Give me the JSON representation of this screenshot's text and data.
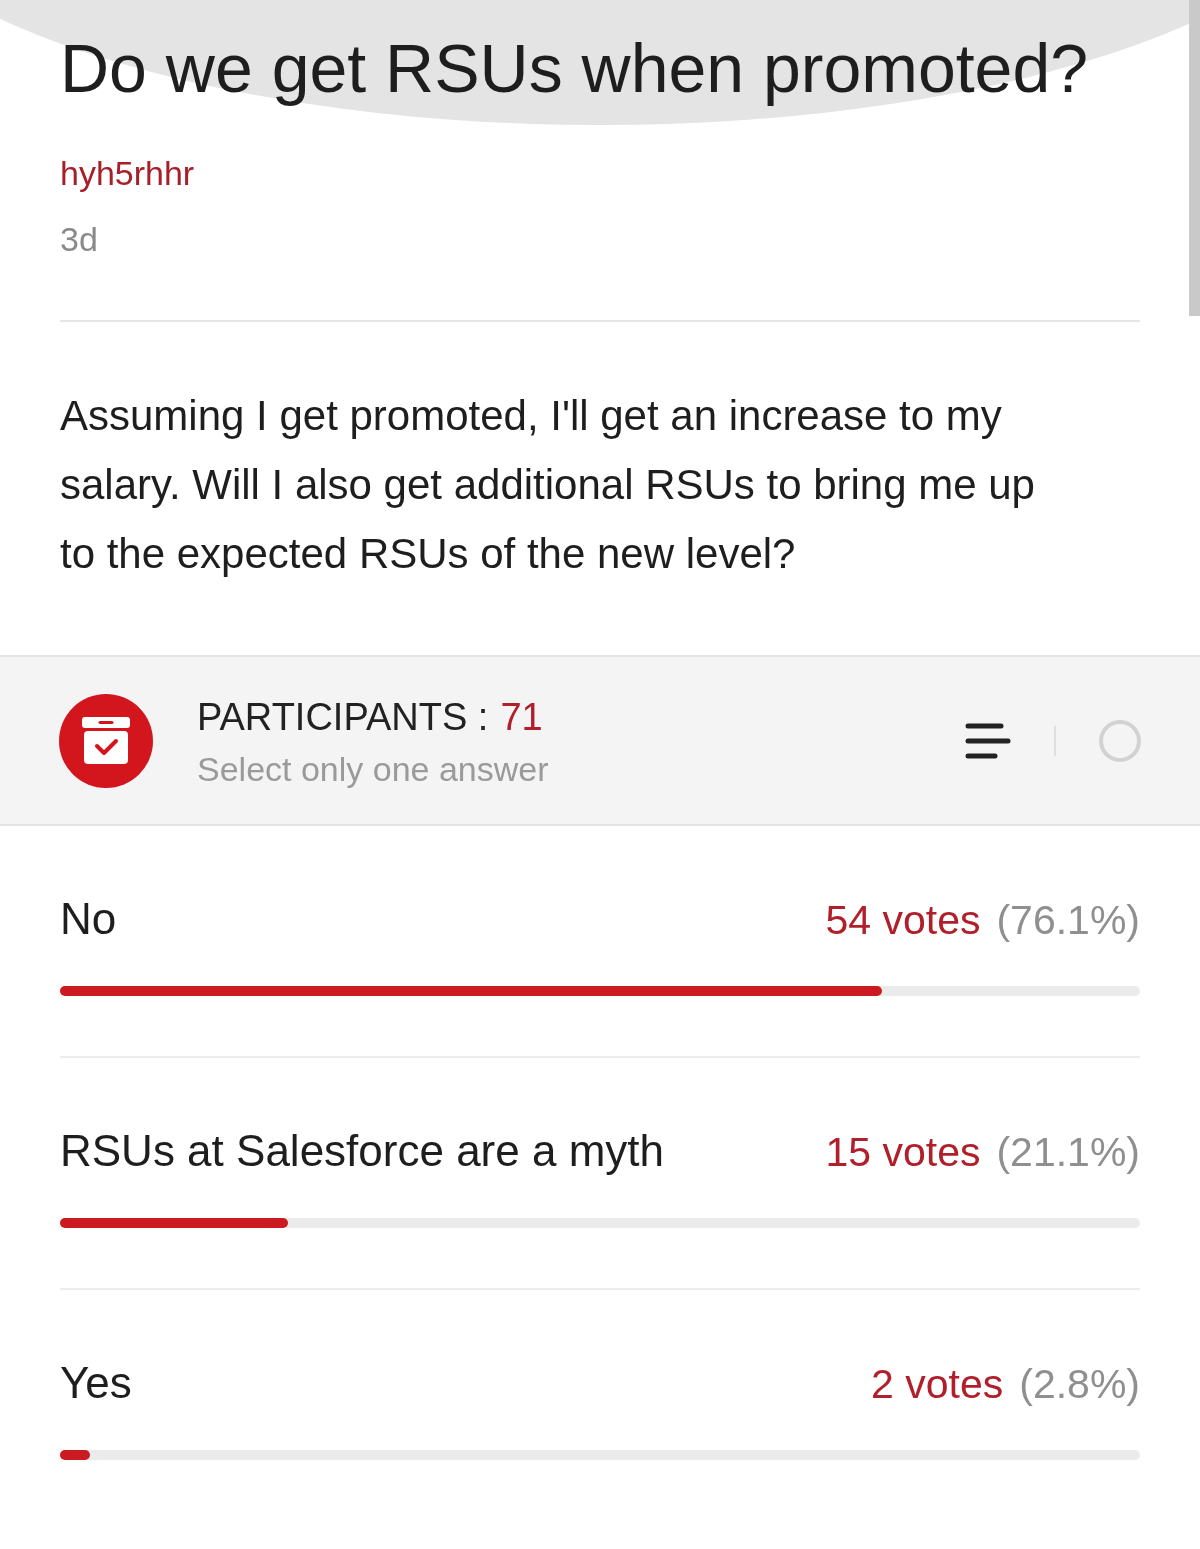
{
  "post": {
    "title": "Do we get RSUs when promoted?",
    "author": "hyh5rhhr",
    "age": "3d",
    "body": "Assuming I get promoted, I'll get an increase to my salary. Will I also get additional RSUs to bring me up to the expected RSUs of the new level?"
  },
  "poll": {
    "participants_label": "PARTICIPANTS :",
    "participants_count": "71",
    "instruction": "Select only one answer",
    "options": [
      {
        "label": "No",
        "votes": "54 votes",
        "percent": "(76.1%)",
        "level": 0.761
      },
      {
        "label": "RSUs at Salesforce are a myth",
        "votes": "15 votes",
        "percent": "(21.1%)",
        "level": 0.211
      },
      {
        "label": "Yes",
        "votes": "2 votes",
        "percent": "(2.8%)",
        "level": 0.028
      }
    ]
  }
}
